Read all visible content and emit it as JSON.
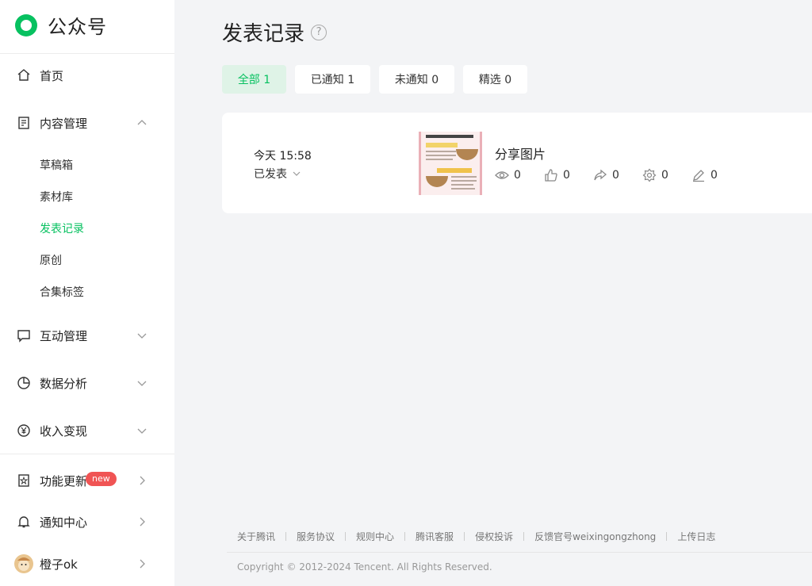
{
  "app": {
    "name": "公众号",
    "brand_color": "#07c160"
  },
  "sidebar": {
    "home": {
      "label": "首页",
      "icon": "home-icon"
    },
    "content": {
      "label": "内容管理",
      "icon": "document-icon",
      "children": [
        "草稿箱",
        "素材库",
        "发表记录",
        "原创",
        "合集标签"
      ],
      "active_child": "发表记录"
    },
    "interaction": {
      "label": "互动管理",
      "icon": "message-icon"
    },
    "analytics": {
      "label": "数据分析",
      "icon": "pie-chart-icon"
    },
    "revenue": {
      "label": "收入变现",
      "icon": "yen-icon"
    },
    "updates": {
      "label": "功能更新",
      "icon": "book-star-icon",
      "badge": "new"
    },
    "notifications": {
      "label": "通知中心",
      "icon": "bell-icon"
    },
    "account": {
      "label": "橙子ok",
      "icon": "avatar"
    }
  },
  "main": {
    "title": "发表记录",
    "help": "?",
    "filters": [
      {
        "label": "全部 1",
        "active": true
      },
      {
        "label": "已通知 1",
        "active": false
      },
      {
        "label": "未通知 0",
        "active": false
      },
      {
        "label": "精选 0",
        "active": false
      }
    ],
    "record": {
      "time": "今天 15:58",
      "status": "已发表",
      "title": "分享图片",
      "stats": {
        "views": "0",
        "likes": "0",
        "shares": "0",
        "recommends": "0",
        "comments": "0"
      }
    }
  },
  "footer": {
    "links": [
      "关于腾讯",
      "服务协议",
      "规则中心",
      "腾讯客服",
      "侵权投诉",
      "反馈官号weixingongzhong",
      "上传日志"
    ],
    "copyright": "Copyright © 2012-2024 Tencent. All Rights Reserved."
  }
}
